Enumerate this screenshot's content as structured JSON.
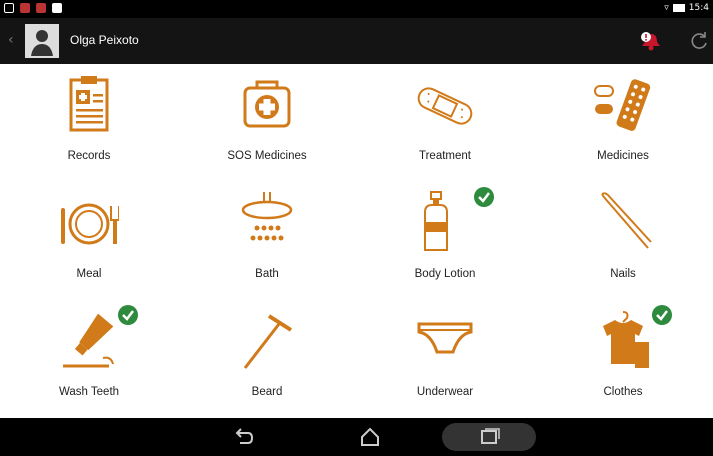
{
  "status_bar": {
    "time": "15:4"
  },
  "header": {
    "user_name": "Olga Peixoto"
  },
  "colors": {
    "accent": "#D17A1A",
    "check": "#2E8B3E",
    "alert": "#C8162B"
  },
  "tiles": [
    {
      "label": "Records",
      "icon": "clipboard-icon",
      "checked": false
    },
    {
      "label": "SOS Medicines",
      "icon": "medical-kit-icon",
      "checked": false
    },
    {
      "label": "Treatment",
      "icon": "bandage-icon",
      "checked": false
    },
    {
      "label": "Medicines",
      "icon": "pills-icon",
      "checked": false
    },
    {
      "label": "Meal",
      "icon": "plate-cutlery-icon",
      "checked": false
    },
    {
      "label": "Bath",
      "icon": "shower-icon",
      "checked": false
    },
    {
      "label": "Body Lotion",
      "icon": "lotion-bottle-icon",
      "checked": true
    },
    {
      "label": "Nails",
      "icon": "nail-clipper-icon",
      "checked": false
    },
    {
      "label": "Wash Teeth",
      "icon": "toothpaste-icon",
      "checked": true
    },
    {
      "label": "Beard",
      "icon": "razor-icon",
      "checked": false
    },
    {
      "label": "Underwear",
      "icon": "underwear-icon",
      "checked": false
    },
    {
      "label": "Clothes",
      "icon": "clothes-icon",
      "checked": true
    }
  ]
}
